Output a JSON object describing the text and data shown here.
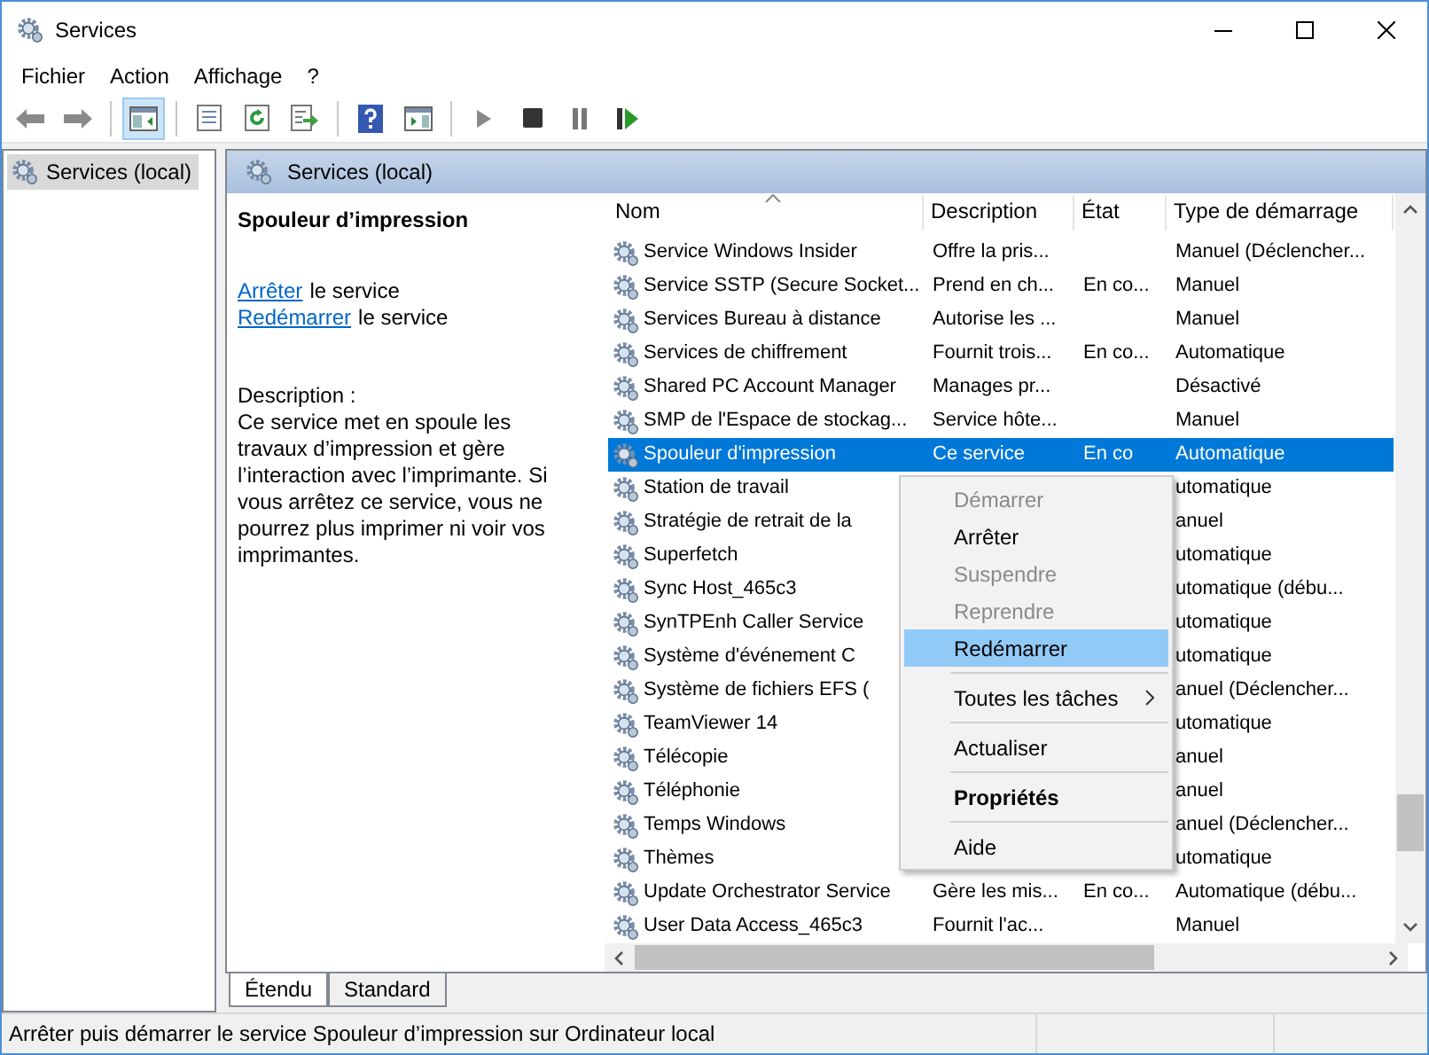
{
  "window": {
    "title": "Services"
  },
  "menu_bar": [
    "Fichier",
    "Action",
    "Affichage",
    "?"
  ],
  "toolbar": [
    {
      "pressed": false
    },
    {
      "pressed": false
    },
    {
      "pressed": true
    },
    {
      "pressed": false
    },
    {
      "pressed": false
    },
    {
      "pressed": false
    },
    {
      "pressed": false
    },
    {
      "pressed": false
    },
    {
      "pressed": false
    },
    {
      "pressed": false
    },
    {
      "pressed": false
    },
    {
      "pressed": false
    }
  ],
  "tree": [
    {
      "label": "Services (local)",
      "selected": true
    }
  ],
  "pane_header": "Services (local)",
  "details": {
    "title": "Spouleur d’impression",
    "actions": [
      {
        "link": "Arrêter",
        "text": "le service"
      },
      {
        "link": "Redémarrer",
        "text": "le service"
      }
    ],
    "description_label": "Description :",
    "description": "Ce service met en spoule les travaux d’impression et gère l’interaction avec l’imprimante. Si vous arrêtez ce service, vous ne pourrez plus imprimer ni voir vos imprimantes."
  },
  "table": {
    "columns": [
      "Nom",
      "Description",
      "État",
      "Type de démarrage"
    ],
    "rows": [
      {
        "name": "Service Windows Insider",
        "description": "Offre la pris...",
        "startup": "Manuel (Déclencher...",
        "selected": false
      },
      {
        "name": "Service SSTP (Secure Socket...",
        "description": "Prend en ch...",
        "state": "En co...",
        "startup": "Manuel",
        "selected": false
      },
      {
        "name": "Services Bureau à distance",
        "description": "Autorise les ...",
        "startup": "Manuel",
        "selected": false
      },
      {
        "name": "Services de chiffrement",
        "description": "Fournit trois...",
        "state": "En co...",
        "startup": "Automatique",
        "selected": false
      },
      {
        "name": "Shared PC Account Manager",
        "description": "Manages pr...",
        "startup": "Désactivé",
        "selected": false
      },
      {
        "name": "SMP de l'Espace de stockag...",
        "description": "Service hôte...",
        "startup": "Manuel",
        "selected": false
      },
      {
        "name": "Spouleur d'impression",
        "description": "Ce service",
        "state": "En co",
        "startup": "Automatique",
        "selected": true
      },
      {
        "name": "Station de travail",
        "startup": "utomatique",
        "selected": false
      },
      {
        "name": "Stratégie de retrait de la",
        "startup": "anuel",
        "selected": false
      },
      {
        "name": "Superfetch",
        "startup": "utomatique",
        "selected": false
      },
      {
        "name": "Sync Host_465c3",
        "startup": "utomatique (débu...",
        "selected": false
      },
      {
        "name": "SynTPEnh Caller Service",
        "startup": "utomatique",
        "selected": false
      },
      {
        "name": "Système d'événement C",
        "startup": "utomatique",
        "selected": false
      },
      {
        "name": "Système de fichiers EFS (",
        "startup": "anuel (Déclencher...",
        "selected": false
      },
      {
        "name": "TeamViewer 14",
        "startup": "utomatique",
        "selected": false
      },
      {
        "name": "Télécopie",
        "startup": "anuel",
        "selected": false
      },
      {
        "name": "Téléphonie",
        "startup": "anuel",
        "selected": false
      },
      {
        "name": "Temps Windows",
        "startup": "anuel (Déclencher...",
        "selected": false
      },
      {
        "name": "Thèmes",
        "startup": "utomatique",
        "selected": false
      },
      {
        "name": "Update Orchestrator Service",
        "description": "Gère les mis...",
        "state": "En co...",
        "startup": "Automatique (débu...",
        "selected": false
      },
      {
        "name": "User Data Access_465c3",
        "description": "Fournit l'ac...",
        "startup": "Manuel",
        "selected": false
      }
    ]
  },
  "context_menu": [
    {
      "kind": "item",
      "label": "Démarrer",
      "disabled": true,
      "highlighted": false,
      "default": false
    },
    {
      "kind": "item",
      "label": "Arrêter",
      "disabled": false,
      "highlighted": false,
      "default": false
    },
    {
      "kind": "item",
      "label": "Suspendre",
      "disabled": true,
      "highlighted": false,
      "default": false
    },
    {
      "kind": "item",
      "label": "Reprendre",
      "disabled": true,
      "highlighted": false,
      "default": false
    },
    {
      "kind": "item",
      "label": "Redémarrer",
      "disabled": false,
      "highlighted": true,
      "default": false
    },
    {
      "kind": "separator"
    },
    {
      "kind": "submenu",
      "label": "Toutes les tâches",
      "disabled": false,
      "highlighted": false,
      "default": false
    },
    {
      "kind": "separator"
    },
    {
      "kind": "item",
      "label": "Actualiser",
      "disabled": false,
      "highlighted": false,
      "default": false
    },
    {
      "kind": "separator"
    },
    {
      "kind": "item",
      "label": "Propriétés",
      "disabled": false,
      "highlighted": false,
      "default": true
    },
    {
      "kind": "separator"
    },
    {
      "kind": "item",
      "label": "Aide",
      "disabled": false,
      "highlighted": false,
      "default": false
    }
  ],
  "bottom_tabs": [
    {
      "label": "Étendu",
      "selected": true
    },
    {
      "label": "Standard",
      "selected": false
    }
  ],
  "status_bar": "Arrêter puis démarrer le service Spouleur d’impression sur Ordinateur local"
}
